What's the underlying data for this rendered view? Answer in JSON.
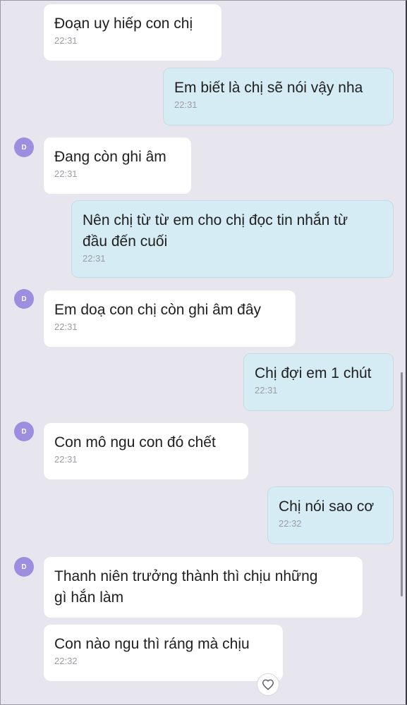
{
  "messages": [
    {
      "dir": "in",
      "avatar": false,
      "text": "Đoạn uy hiếp con chị",
      "time": "22:31"
    },
    {
      "dir": "out",
      "text": "Em biết là chị sẽ nói vậy nha",
      "time": "22:31"
    },
    {
      "dir": "in",
      "avatar": true,
      "text": "Đang còn ghi âm",
      "time": "22:31"
    },
    {
      "dir": "out",
      "text": "Nên chị từ từ em cho chị đọc tin nhắn từ\nđầu đến cuối",
      "time": "22:31"
    },
    {
      "dir": "in",
      "avatar": true,
      "text": "Em doạ con chị còn ghi âm đây",
      "time": "22:31"
    },
    {
      "dir": "out",
      "text": "Chị đợi em 1 chút",
      "time": "22:31"
    },
    {
      "dir": "in",
      "avatar": true,
      "text": "Con mô ngu con đó chết",
      "time": "22:31"
    },
    {
      "dir": "out",
      "text": "Chị nói sao cơ",
      "time": "22:32"
    },
    {
      "dir": "in",
      "avatar": true,
      "text": "Thanh niên trưởng thành thì chịu những\ngì hắn làm",
      "time": ""
    },
    {
      "dir": "in",
      "avatar": false,
      "text": "Con nào ngu thì ráng mà chịu",
      "time": "22:32"
    }
  ],
  "avatar_letter": "D",
  "colors": {
    "background": "#e7e6ef",
    "incoming": "#ffffff",
    "outgoing": "#d6ecf5",
    "avatar": "#9d8ee0"
  },
  "icons": {
    "reaction": "heart-icon"
  }
}
